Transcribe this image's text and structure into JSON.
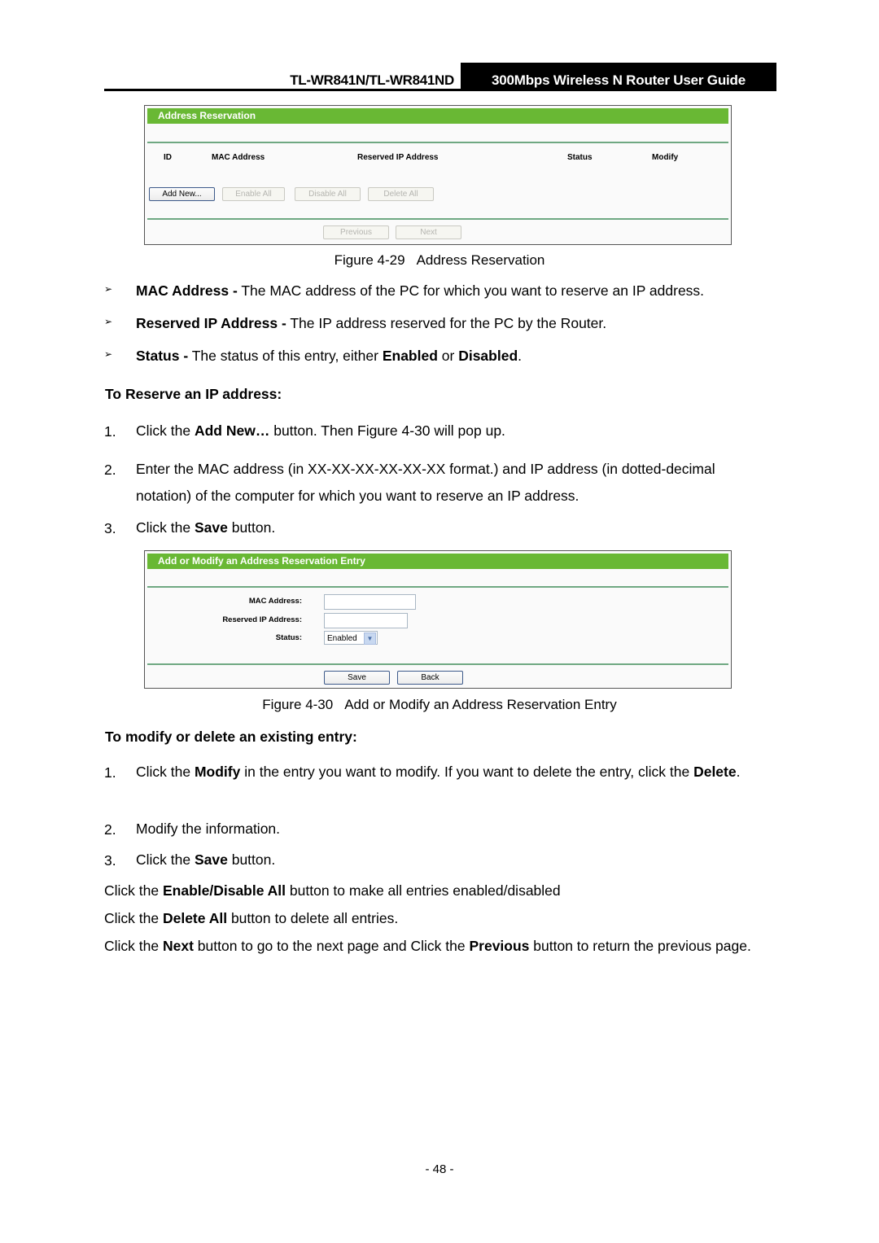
{
  "header": {
    "model": "TL-WR841N/TL-WR841ND",
    "guide_title": "300Mbps Wireless N Router User Guide"
  },
  "figure_29": {
    "panel_title": "Address Reservation",
    "columns": [
      "ID",
      "MAC Address",
      "Reserved IP Address",
      "Status",
      "Modify"
    ],
    "buttons": {
      "add_new": "Add New...",
      "enable_all": "Enable All",
      "disable_all": "Disable All",
      "delete_all": "Delete All",
      "previous": "Previous",
      "next": "Next"
    },
    "caption_number": "Figure 4-29",
    "caption_text": "Address Reservation"
  },
  "bullets": [
    {
      "term": "MAC Address -",
      "text": " The MAC address of the PC for which you want to reserve an IP address."
    },
    {
      "term": "Reserved IP Address -",
      "text": " The IP address reserved for the PC by the Router."
    },
    {
      "term": "Status -",
      "text": " The status of this entry, either ",
      "b1": "Enabled",
      "mid": " or ",
      "b2": "Disabled",
      "end": "."
    }
  ],
  "reserve_section": {
    "heading": "To Reserve an IP address:",
    "steps": [
      {
        "num": "1.",
        "pre": "Click the ",
        "bold": "Add New…",
        "post": " button. Then Figure 4-30 will pop up."
      },
      {
        "num": "2.",
        "pre": "Enter the MAC address (in XX-XX-XX-XX-XX-XX format.) and IP address (in dotted-decimal notation) of the computer for which you want to reserve an IP address.",
        "bold": "",
        "post": ""
      },
      {
        "num": "3.",
        "pre": "Click the ",
        "bold": "Save",
        "post": " button."
      }
    ]
  },
  "figure_30": {
    "panel_title": "Add or Modify an Address Reservation Entry",
    "fields": {
      "mac_label": "MAC Address:",
      "mac_value": "",
      "ip_label": "Reserved IP Address:",
      "ip_value": "",
      "status_label": "Status:",
      "status_value": "Enabled"
    },
    "buttons": {
      "save": "Save",
      "back": "Back"
    },
    "caption_number": "Figure 4-30",
    "caption_text": "Add or Modify an Address Reservation Entry"
  },
  "modify_section": {
    "heading": "To modify or delete an existing entry:",
    "steps": [
      {
        "num": "1.",
        "pre": "Click the ",
        "bold": "Modify",
        "post": " in the entry you want to modify. If you want to delete the entry, click the ",
        "bold2": "Delete",
        "end": "."
      },
      {
        "num": "2.",
        "pre": "Modify the information."
      },
      {
        "num": "3.",
        "pre": "Click the ",
        "bold": "Save",
        "post": " button."
      }
    ]
  },
  "notes": [
    {
      "pre": "Click the ",
      "bold": "Enable/Disable All",
      "post": " button to make all entries enabled/disabled"
    },
    {
      "pre": "Click the ",
      "bold": "Delete All",
      "post": " button to delete all entries."
    },
    {
      "pre": "Click the ",
      "bold": "Next",
      "mid": " button to go to the next page and Click the ",
      "bold2": "Previous",
      "post": " button to return the previous page."
    }
  ],
  "page_number": "- 48 -",
  "colors": {
    "panel_green": "#69b834",
    "rule_green": "#6fa882",
    "header_black": "#000000"
  },
  "icons": {
    "bullet": "arrowhead-bullet-icon",
    "select_arrow": "chevron-down-icon"
  }
}
